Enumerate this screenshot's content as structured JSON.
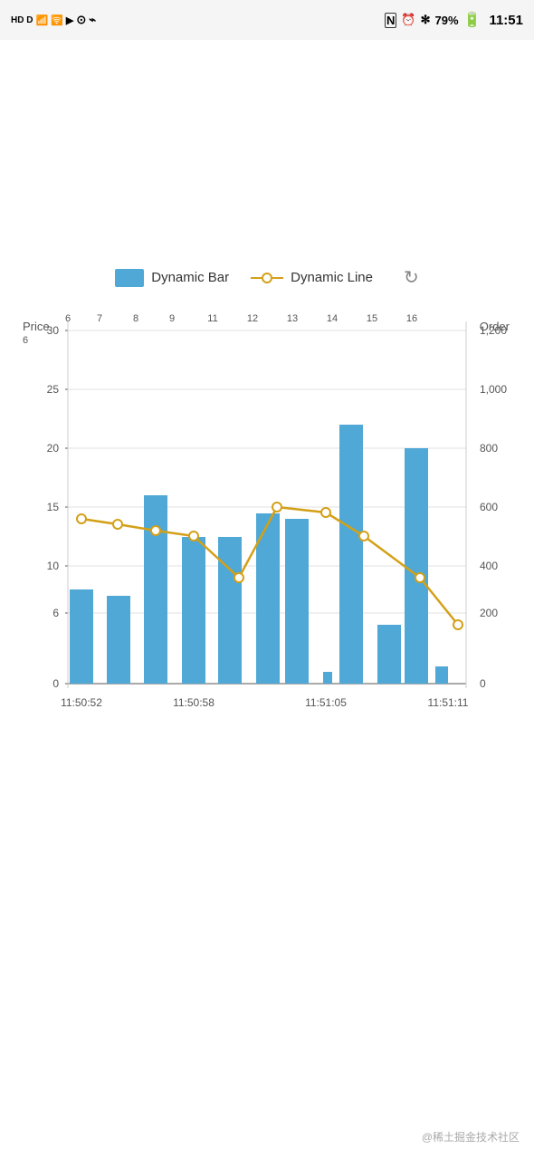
{
  "statusBar": {
    "time": "11:51",
    "battery": "79%",
    "leftIcons": "HD D  4G  46  46  ⁪  ▶  ◉  ψ",
    "rightIcons": "N  ⏰  ❊  ❊IO  79%  🔋"
  },
  "legend": {
    "barLabel": "Dynamic Bar",
    "lineLabel": "Dynamic Line",
    "refreshLabel": "↻"
  },
  "chart": {
    "leftAxisLabel": "Price",
    "rightAxisLabel": "Order",
    "leftAxisValues": [
      "30",
      "25",
      "20",
      "15",
      "10",
      "6",
      "0"
    ],
    "rightAxisValues": [
      "1,200",
      "1,000",
      "800",
      "600",
      "400",
      "200",
      "0"
    ],
    "xLabels": [
      "6",
      "7",
      "8",
      "9",
      "11",
      "12",
      "13",
      "14",
      "15",
      "16"
    ],
    "timeLabels": [
      "11:50:52",
      "11:50:58",
      "11:51:05",
      "11:51:11"
    ],
    "barColor": "#4fa8d5",
    "lineColor": "#d4a017",
    "gridColor": "#e0e0e0"
  },
  "watermark": "@稀土掘金技术社区"
}
